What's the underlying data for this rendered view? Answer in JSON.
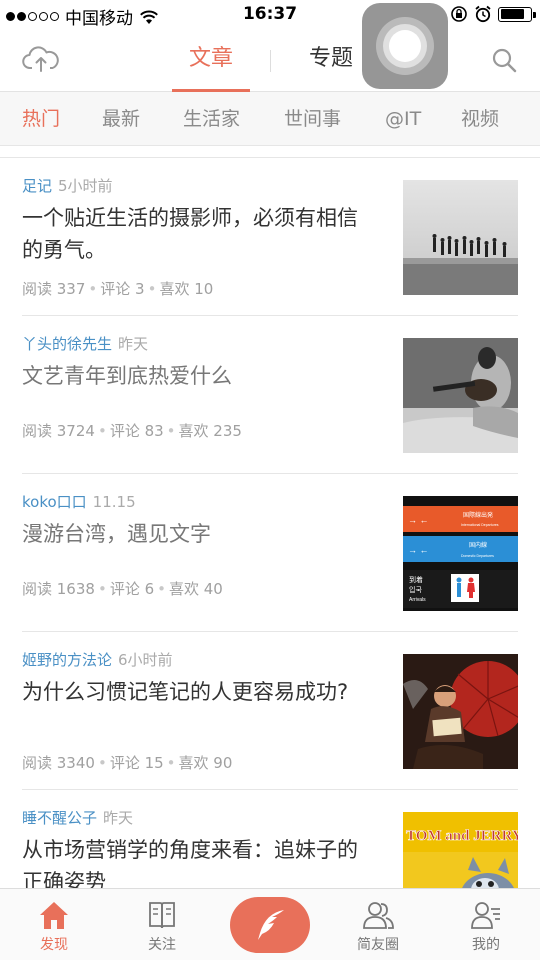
{
  "status_bar": {
    "carrier": "中国移动",
    "time": "16:37",
    "signal_bars": 2,
    "battery_level": 0.8
  },
  "header": {
    "tabs": [
      {
        "label": "文章",
        "active": true
      },
      {
        "label": "专题",
        "active": false
      }
    ],
    "upload_icon": "cloud-upload-icon",
    "search_icon": "search-icon"
  },
  "categories": [
    {
      "label": "热门",
      "active": true
    },
    {
      "label": "最新",
      "active": false
    },
    {
      "label": "生活家",
      "active": false
    },
    {
      "label": "世间事",
      "active": false
    },
    {
      "label": "@IT",
      "active": false
    },
    {
      "label": "视频",
      "active": false
    }
  ],
  "articles": [
    {
      "author": "足记",
      "time": "5小时前",
      "title": "一个贴近生活的摄影师，必须有相信的勇气。",
      "stats": {
        "reads": "阅读 337",
        "comments": "评论 3",
        "likes": "喜欢 10"
      },
      "read": false
    },
    {
      "author": "丫头的徐先生",
      "time": "昨天",
      "title": "文艺青年到底热爱什么",
      "stats": {
        "reads": "阅读 3724",
        "comments": "评论 83",
        "likes": "喜欢 235"
      },
      "read": true
    },
    {
      "author": "koko口口",
      "time": "11.15",
      "title": "漫游台湾，遇见文字",
      "stats": {
        "reads": "阅读 1638",
        "comments": "评论 6",
        "likes": "喜欢 40"
      },
      "read": true
    },
    {
      "author": "姬野的方法论",
      "time": "6小时前",
      "title": "为什么习惯记笔记的人更容易成功?",
      "stats": {
        "reads": "阅读 3340",
        "comments": "评论 15",
        "likes": "喜欢 90"
      },
      "read": false
    },
    {
      "author": "睡不醒公子",
      "time": "昨天",
      "title": "从市场营销学的角度来看：追妹子的正确姿势",
      "stats": {
        "reads": "",
        "comments": "",
        "likes": ""
      },
      "read": false
    }
  ],
  "thumb_text": {
    "sign_top": "国際線出発",
    "sign_top_en": "International Departures",
    "sign_mid": "国内線",
    "sign_mid_en": "Domestic Departures",
    "sign_bottom": "到着",
    "sign_bottom_kr": "입국",
    "sign_bottom_en": "Arrivals",
    "cartoon": "TOM and JERRY"
  },
  "bottom_nav": [
    {
      "label": "发现",
      "icon": "home-icon",
      "active": true
    },
    {
      "label": "关注",
      "icon": "book-icon",
      "active": false
    },
    {
      "label": "",
      "icon": "quill-icon",
      "active": false
    },
    {
      "label": "简友圈",
      "icon": "friends-icon",
      "active": false
    },
    {
      "label": "我的",
      "icon": "profile-icon",
      "active": false
    }
  ],
  "colors": {
    "accent": "#e8705a",
    "author_link": "#4a90c5",
    "category_bar_bg": "#f7f7f7"
  }
}
